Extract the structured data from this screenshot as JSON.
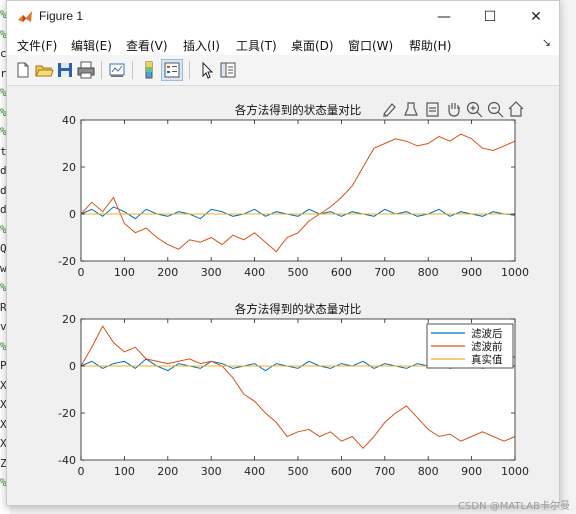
{
  "window": {
    "title": "Figure 1",
    "controls": {
      "minimize": "—",
      "maximize": "☐",
      "close": "✕"
    }
  },
  "menu": {
    "items": [
      "文件(F)",
      "编辑(E)",
      "查看(V)",
      "插入(I)",
      "工具(T)",
      "桌面(D)",
      "窗口(W)",
      "帮助(H)"
    ],
    "arrow": "↘"
  },
  "toolbar": {
    "icons": [
      "new-figure-icon",
      "open-file-icon",
      "save-icon",
      "print-icon",
      "link-plot-icon",
      "colorbar-icon",
      "legend-icon",
      "pointer-icon",
      "property-inspector-icon"
    ]
  },
  "axes_toolbar": {
    "icons": [
      "brush-icon",
      "data-tips-icon",
      "export-icon",
      "pan-icon",
      "zoom-in-icon",
      "zoom-out-icon",
      "home-icon"
    ]
  },
  "left_strip": {
    "chars": [
      "%",
      "%",
      "c",
      "r",
      "%",
      "%",
      "%",
      "t",
      "d",
      "d",
      "d",
      "%",
      "Q",
      "w",
      "%",
      "R",
      "v",
      "%",
      "P",
      "X",
      "X",
      "X",
      "X",
      "Z",
      "%"
    ]
  },
  "colors": {
    "filtered": "#0072bd",
    "raw": "#d95319",
    "truth": "#edb120"
  },
  "watermark": "CSDN @MATLAB卡尔曼",
  "chart_data": [
    {
      "type": "line",
      "title": "各方法得到的状态量对比",
      "xlim": [
        0,
        1000
      ],
      "ylim": [
        -20,
        40
      ],
      "xticks": [
        0,
        100,
        200,
        300,
        400,
        500,
        600,
        700,
        800,
        900,
        1000
      ],
      "yticks": [
        -20,
        0,
        20,
        40
      ],
      "grid": false,
      "legend": false,
      "series": [
        {
          "color": "#0072bd",
          "x": [
            0,
            25,
            50,
            75,
            100,
            125,
            150,
            175,
            200,
            225,
            250,
            275,
            300,
            325,
            350,
            375,
            400,
            425,
            450,
            475,
            500,
            525,
            550,
            575,
            600,
            625,
            650,
            675,
            700,
            725,
            750,
            775,
            800,
            825,
            850,
            875,
            900,
            925,
            950,
            975,
            1000
          ],
          "y": [
            0,
            2,
            -1,
            3,
            1,
            -2,
            2,
            0,
            -1,
            1,
            0,
            -2,
            2,
            1,
            -1,
            0,
            2,
            -1,
            1,
            0,
            -1,
            2,
            0,
            1,
            -1,
            1,
            0,
            -1,
            2,
            0,
            1,
            -1,
            0,
            2,
            -1,
            1,
            0,
            -1,
            1,
            0,
            -0.5
          ]
        },
        {
          "color": "#d95319",
          "x": [
            0,
            25,
            50,
            75,
            100,
            125,
            150,
            175,
            200,
            225,
            250,
            275,
            300,
            325,
            350,
            375,
            400,
            425,
            450,
            475,
            500,
            525,
            550,
            575,
            600,
            625,
            650,
            675,
            700,
            725,
            750,
            775,
            800,
            825,
            850,
            875,
            900,
            925,
            950,
            975,
            1000
          ],
          "y": [
            0,
            5,
            1,
            7,
            -4,
            -8,
            -6,
            -10,
            -13,
            -15,
            -11,
            -12,
            -10,
            -13,
            -9,
            -11,
            -8,
            -12,
            -16,
            -10,
            -8,
            -3,
            0,
            3,
            7,
            12,
            20,
            28,
            30,
            32,
            31,
            29,
            30,
            33,
            31,
            34,
            32,
            28,
            27,
            29,
            31
          ]
        },
        {
          "color": "#edb120",
          "x": [
            0,
            1000
          ],
          "y": [
            0,
            0
          ]
        }
      ]
    },
    {
      "type": "line",
      "title": "各方法得到的状态量对比",
      "xlim": [
        0,
        1000
      ],
      "ylim": [
        -40,
        20
      ],
      "xticks": [
        0,
        100,
        200,
        300,
        400,
        500,
        600,
        700,
        800,
        900,
        1000
      ],
      "yticks": [
        -40,
        -20,
        0,
        20
      ],
      "grid": false,
      "legend_position": "top-right",
      "series": [
        {
          "name": "滤波后",
          "color": "#0072bd",
          "x": [
            0,
            25,
            50,
            75,
            100,
            125,
            150,
            175,
            200,
            225,
            250,
            275,
            300,
            325,
            350,
            375,
            400,
            425,
            450,
            475,
            500,
            525,
            550,
            575,
            600,
            625,
            650,
            675,
            700,
            725,
            750,
            775,
            800,
            825,
            850,
            875,
            900,
            925,
            950,
            975,
            1000
          ],
          "y": [
            0,
            2,
            -1,
            1,
            2,
            -1,
            3,
            0,
            -2,
            1,
            0,
            -1,
            2,
            1,
            -1,
            0,
            1,
            -2,
            1,
            0,
            -1,
            2,
            0,
            -1,
            1,
            0,
            2,
            -1,
            1,
            0,
            -1,
            1,
            0,
            2,
            -1,
            0,
            1,
            -1,
            0,
            2,
            4
          ]
        },
        {
          "name": "滤波前",
          "color": "#d95319",
          "x": [
            0,
            25,
            50,
            75,
            100,
            125,
            150,
            175,
            200,
            225,
            250,
            275,
            300,
            325,
            350,
            375,
            400,
            425,
            450,
            475,
            500,
            525,
            550,
            575,
            600,
            625,
            650,
            675,
            700,
            725,
            750,
            775,
            800,
            825,
            850,
            875,
            900,
            925,
            950,
            975,
            1000
          ],
          "y": [
            0,
            8,
            17,
            10,
            6,
            8,
            3,
            2,
            1,
            2,
            3,
            1,
            2,
            0,
            -5,
            -12,
            -15,
            -20,
            -24,
            -30,
            -28,
            -27,
            -30,
            -28,
            -32,
            -30,
            -35,
            -30,
            -24,
            -20,
            -17,
            -22,
            -27,
            -30,
            -29,
            -32,
            -30,
            -28,
            -30,
            -32,
            -30
          ]
        },
        {
          "name": "真实值",
          "color": "#edb120",
          "x": [
            0,
            1000
          ],
          "y": [
            0,
            0
          ]
        }
      ]
    }
  ]
}
